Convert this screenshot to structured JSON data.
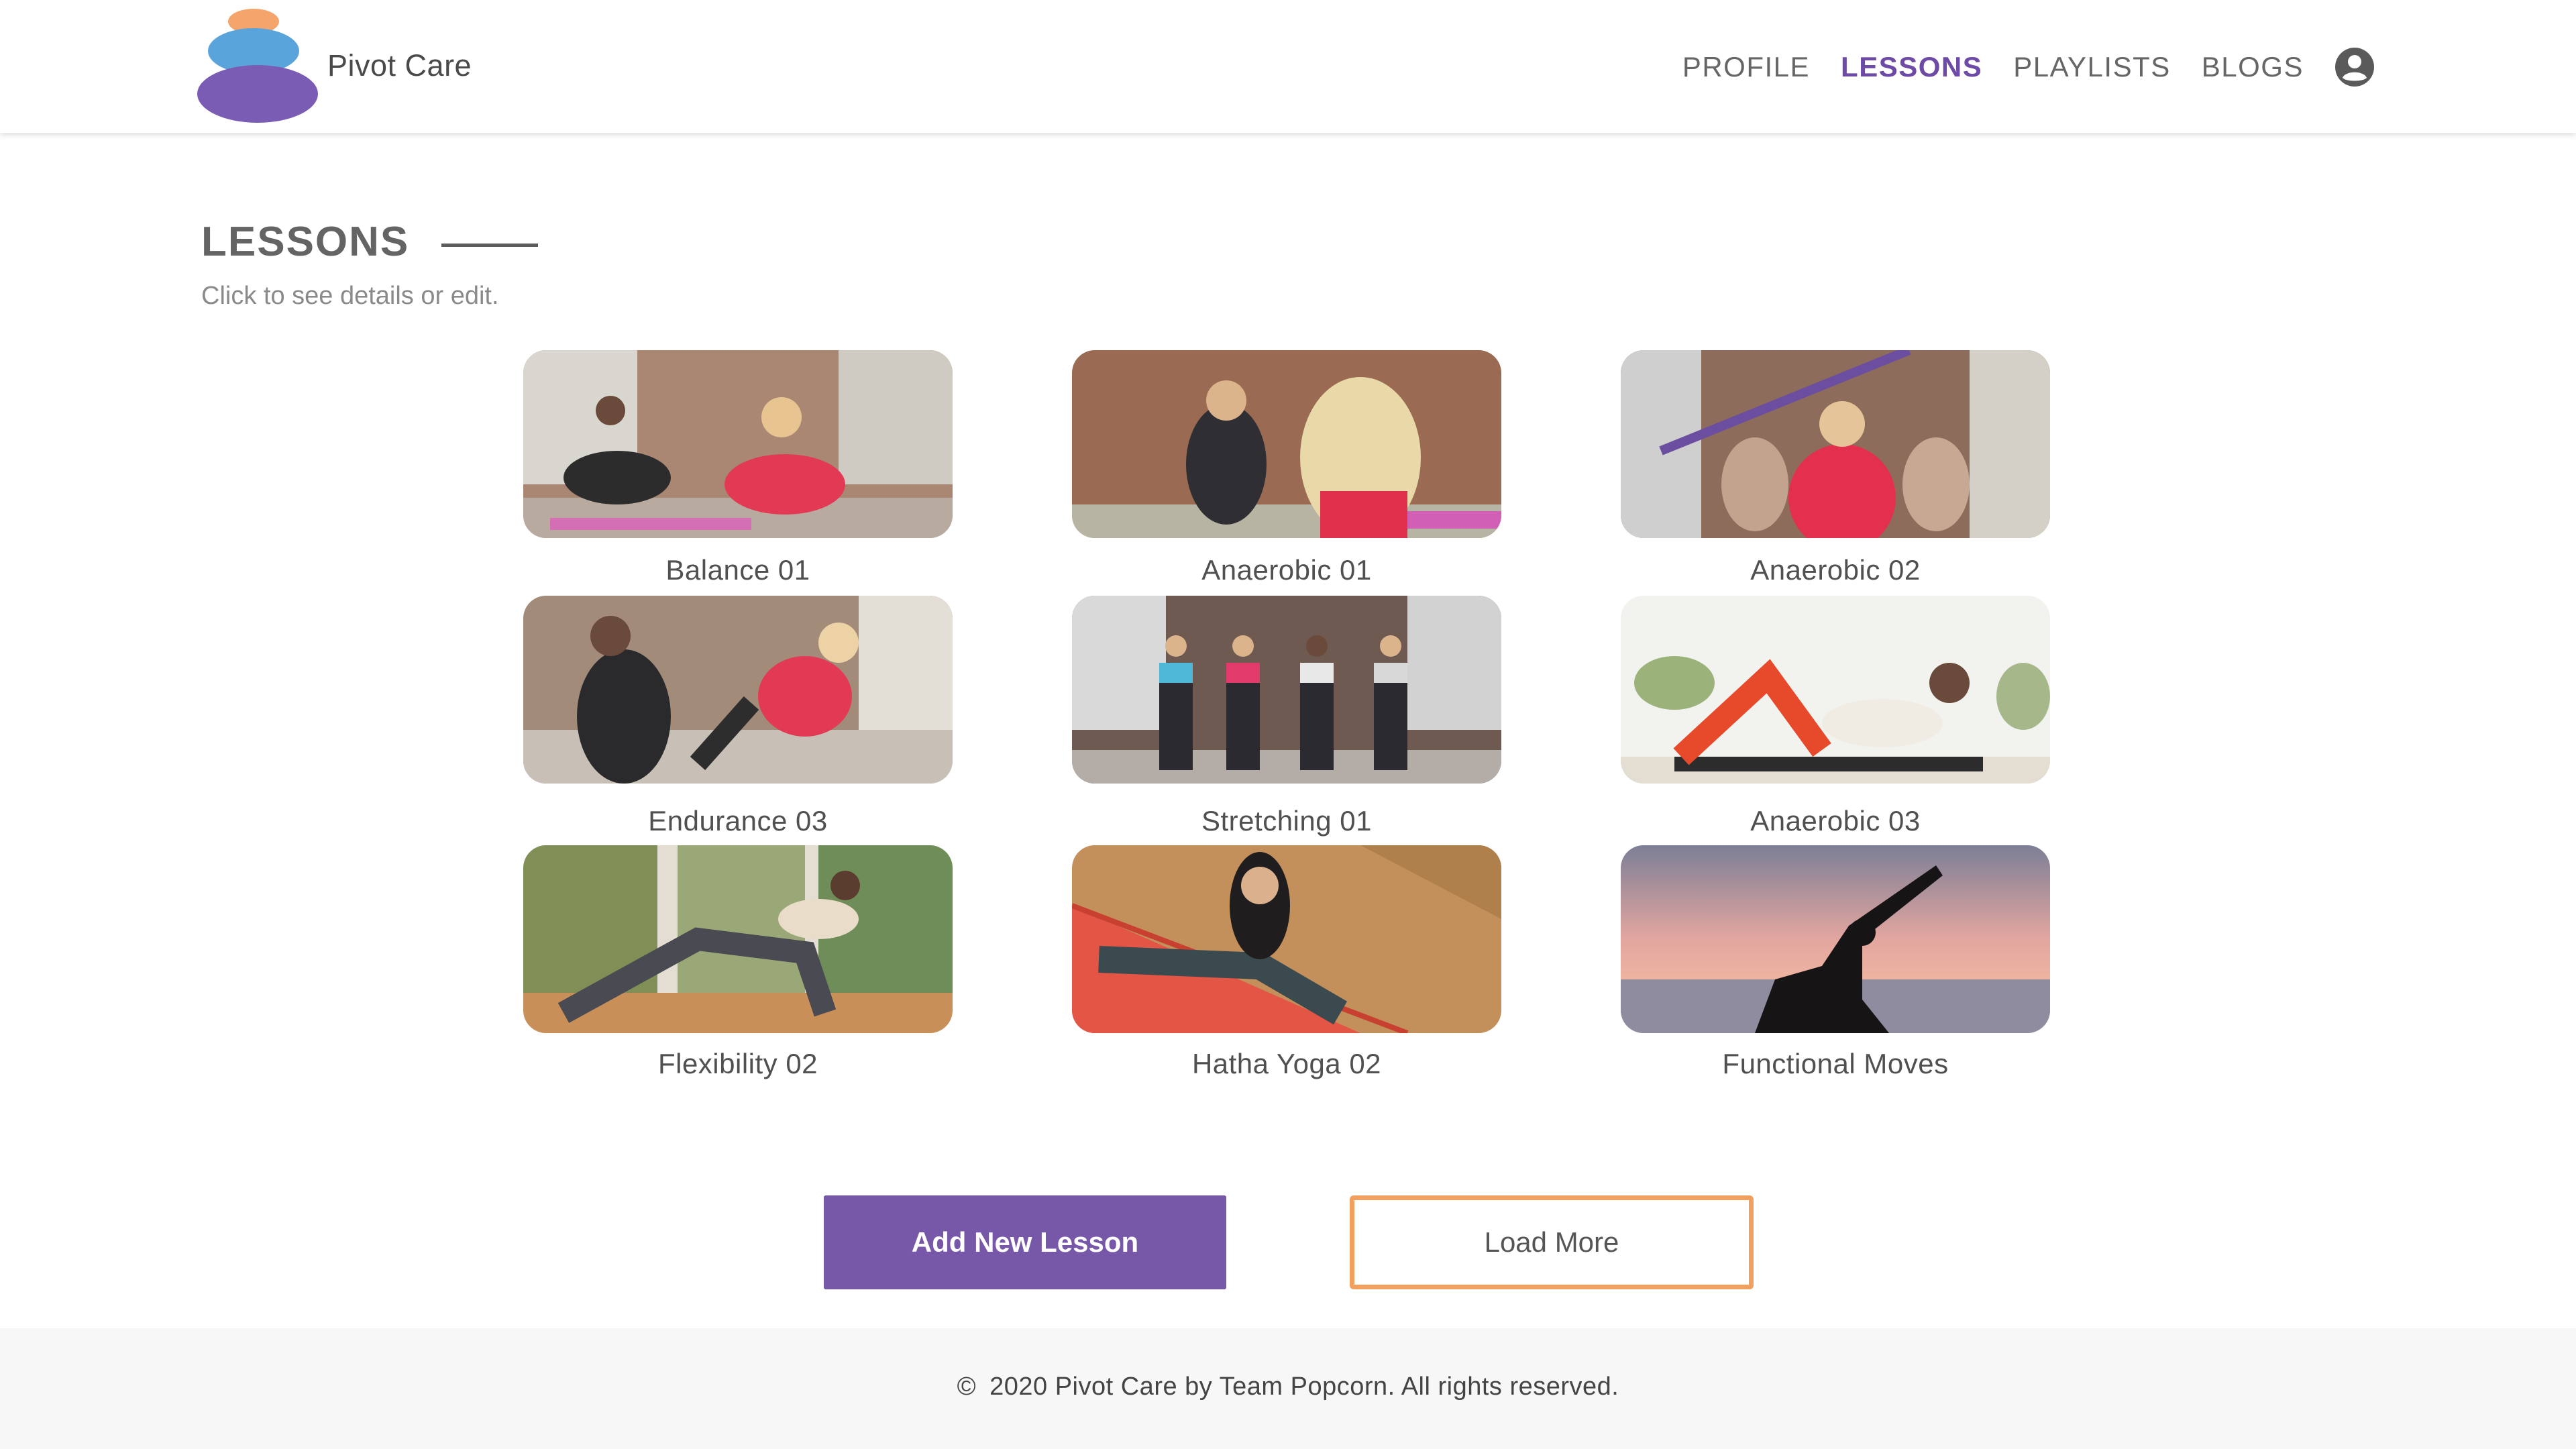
{
  "brand": {
    "name": "Pivot Care"
  },
  "nav": {
    "items": [
      {
        "label": "PROFILE",
        "active": false
      },
      {
        "label": "LESSONS",
        "active": true
      },
      {
        "label": "PLAYLISTS",
        "active": false
      },
      {
        "label": "BLOGS",
        "active": false
      }
    ],
    "account_icon": "account-circle-icon"
  },
  "page": {
    "title": "LESSONS",
    "subtitle": "Click to see details or edit."
  },
  "lessons": [
    {
      "label": "Balance 01"
    },
    {
      "label": "Anaerobic 01"
    },
    {
      "label": "Anaerobic 02"
    },
    {
      "label": "Endurance 03"
    },
    {
      "label": "Stretching 01"
    },
    {
      "label": "Anaerobic 03"
    },
    {
      "label": "Flexibility 02"
    },
    {
      "label": "Hatha Yoga 02"
    },
    {
      "label": "Functional Moves"
    }
  ],
  "buttons": {
    "add_label": "Add New Lesson",
    "more_label": "Load More"
  },
  "footer": {
    "copyright_symbol": "©",
    "text": "2020 Pivot Care by Team Popcorn. All rights reserved."
  },
  "colors": {
    "accent": "#7657a8",
    "nav_active": "#6c4aa6",
    "load_more_border": "#f2a060",
    "logo_orange": "#f5a46b",
    "logo_blue": "#5aa4dc",
    "logo_purple": "#7b5cb4"
  }
}
